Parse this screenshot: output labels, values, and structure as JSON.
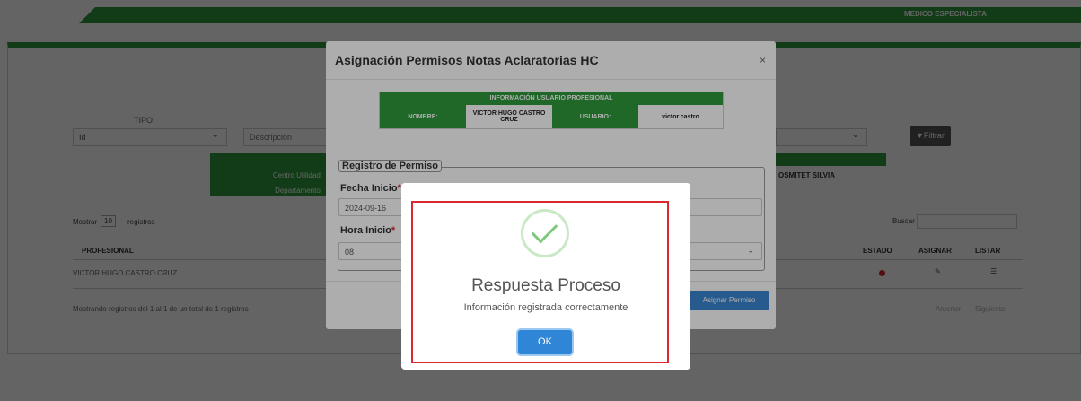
{
  "header": {
    "role_label": "MEDICO ESPECIALISTA"
  },
  "filters": {
    "tipo_label": "TIPO:",
    "tipo_value": "Id",
    "descripcion_placeholder": "Descripcion",
    "filtrar_label": "Filtrar"
  },
  "info_band": {
    "centro_label": "Centro Utilidad:",
    "departamento_label": "Departamento:",
    "name_fragment": "OSMITET SILVIA"
  },
  "table_controls": {
    "mostrar_label": "Mostrar",
    "page_size": "10",
    "registros_label": "registros",
    "buscar_label": "Buscar"
  },
  "table": {
    "headers": [
      "PROFESIONAL",
      "ESTADO",
      "ASIGNAR",
      "LISTAR"
    ],
    "rows": [
      {
        "profesional": "VICTOR HUGO CASTRO CRUZ"
      }
    ],
    "footer_text": "Mostrando registros del 1 al 1 de un total de 1 registros",
    "prev_label": "Anterior",
    "next_label": "Siguiente"
  },
  "modal": {
    "title": "Asignación Permisos Notas Aclaratorias HC",
    "close_symbol": "×",
    "user_table": {
      "title": "INFORMACIÓN USUARIO PROFESIONAL",
      "nombre_label": "NOMBRE:",
      "nombre_value": "VICTOR HUGO CASTRO CRUZ",
      "usuario_label": "USUARIO:",
      "usuario_value": "victor.castro"
    },
    "section_legend": "Registro de Permiso",
    "fecha_inicio_label": "Fecha Inicio",
    "fecha_inicio_value": "2024-09-16",
    "hora_inicio_label": "Hora Inicio",
    "hora_inicio_value": "08",
    "required_mark": "*",
    "asignar_button": "Asignar Permiso"
  },
  "alert": {
    "title": "Respuesta Proceso",
    "text": "Información registrada correctamente",
    "ok_label": "OK"
  },
  "colors": {
    "brand_green": "#2f9a3c",
    "accent_blue": "#2f86d6",
    "highlight_red": "#d9282f"
  }
}
